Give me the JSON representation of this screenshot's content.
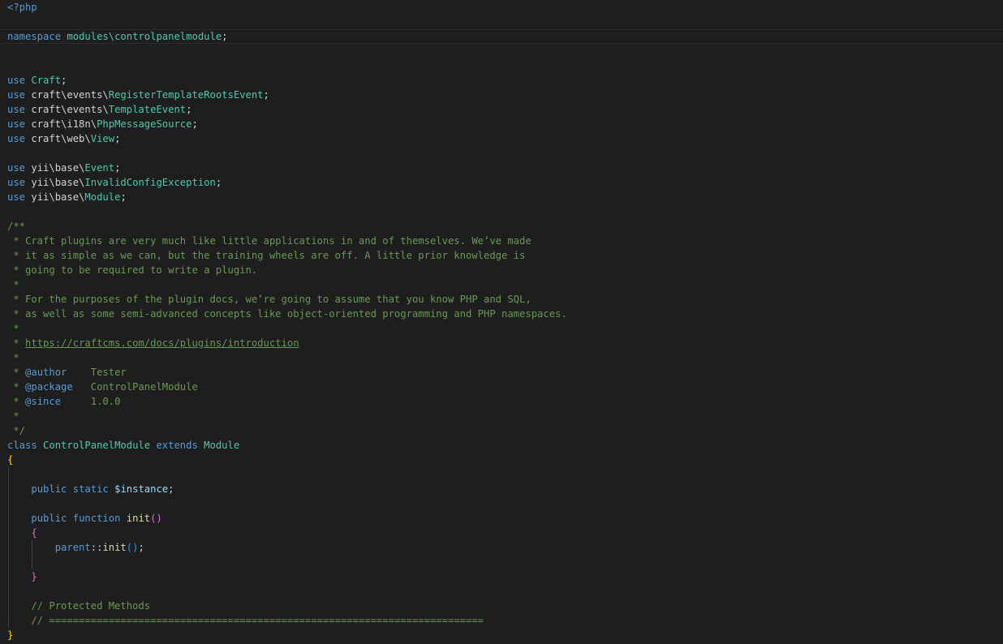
{
  "editor": {
    "language": "php",
    "lines": {
      "l1": "<?php",
      "l3_kw": "namespace",
      "l3_ns": "modules\\controlpanelmodule",
      "use": "use",
      "u1_cls": "Craft",
      "u2_ns": "craft\\events\\",
      "u2_cls": "RegisterTemplateRootsEvent",
      "u3_ns": "craft\\events\\",
      "u3_cls": "TemplateEvent",
      "u4_ns": "craft\\i18n\\",
      "u4_cls": "PhpMessageSource",
      "u5_ns": "craft\\web\\",
      "u5_cls": "View",
      "u6_ns": "yii\\base\\",
      "u6_cls": "Event",
      "u7_ns": "yii\\base\\",
      "u7_cls": "InvalidConfigException",
      "u8_ns": "yii\\base\\",
      "u8_cls": "Module",
      "semi": ";",
      "c_open": "/**",
      "c1": " * Craft plugins are very much like little applications in and of themselves. We’ve made",
      "c2": " * it as simple as we can, but the training wheels are off. A little prior knowledge is",
      "c3": " * going to be required to write a plugin.",
      "c_star": " *",
      "c4": " * For the purposes of the plugin docs, we’re going to assume that you know PHP and SQL,",
      "c5": " * as well as some semi-advanced concepts like object-oriented programming and PHP namespaces.",
      "c_link_prefix": " * ",
      "c_link": "https://craftcms.com/docs/plugins/introduction",
      "c_author_tag": "@author",
      "c_author_val": "    Tester",
      "c_package_tag": "@package",
      "c_package_val": "   ControlPanelModule",
      "c_since_tag": "@since",
      "c_since_val": "     1.0.0",
      "c_close": " */",
      "class_kw": "class",
      "class_name": "ControlPanelModule",
      "extends_kw": "extends",
      "extends_name": "Module",
      "brace_open": "{",
      "brace_close": "}",
      "public_kw": "public",
      "static_kw": "static",
      "instance_var": "$instance",
      "function_kw": "function",
      "init_fn": "init",
      "paren_open": "(",
      "paren_close": ")",
      "parent_kw": "parent",
      "dcolon": "::",
      "cmt_protected": "// Protected Methods",
      "cmt_rule": "// ========================================================================="
    }
  }
}
